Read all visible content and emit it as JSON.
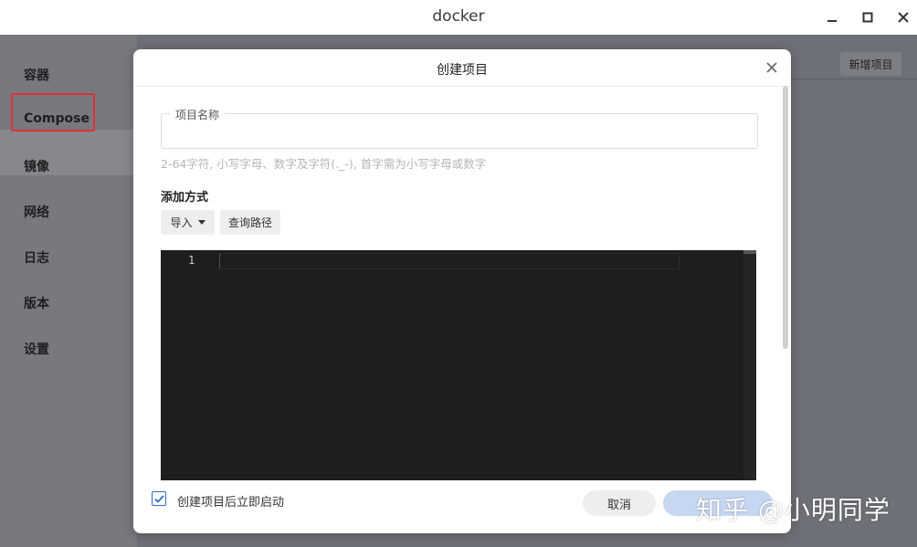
{
  "window": {
    "title": "docker"
  },
  "sidebar": {
    "items": [
      {
        "label": "容器"
      },
      {
        "label": "Compose"
      },
      {
        "label": "镜像"
      },
      {
        "label": "网络"
      },
      {
        "label": "日志"
      },
      {
        "label": "版本"
      },
      {
        "label": "设置"
      }
    ],
    "active": "Compose"
  },
  "main": {
    "new_project_label": "新增项目"
  },
  "dialog": {
    "title": "创建项目",
    "project_name": {
      "label": "项目名称",
      "value": "",
      "hint": "2-64字符, 小写字母、数字及字符(._-), 首字需为小写字母或数字"
    },
    "add_method": {
      "title": "添加方式",
      "import_label": "导入",
      "query_path_label": "查询路径"
    },
    "editor": {
      "line_numbers": [
        "1"
      ],
      "content": ""
    },
    "auto_start": {
      "label": "创建项目后立即启动",
      "checked": true
    },
    "buttons": {
      "cancel": "取消",
      "confirm": ""
    }
  },
  "watermark": {
    "text": "知乎 @小明同学"
  },
  "colors": {
    "accent": "#2b6bc4",
    "highlight": "#d33333",
    "editor_bg": "#1e1e1e"
  }
}
